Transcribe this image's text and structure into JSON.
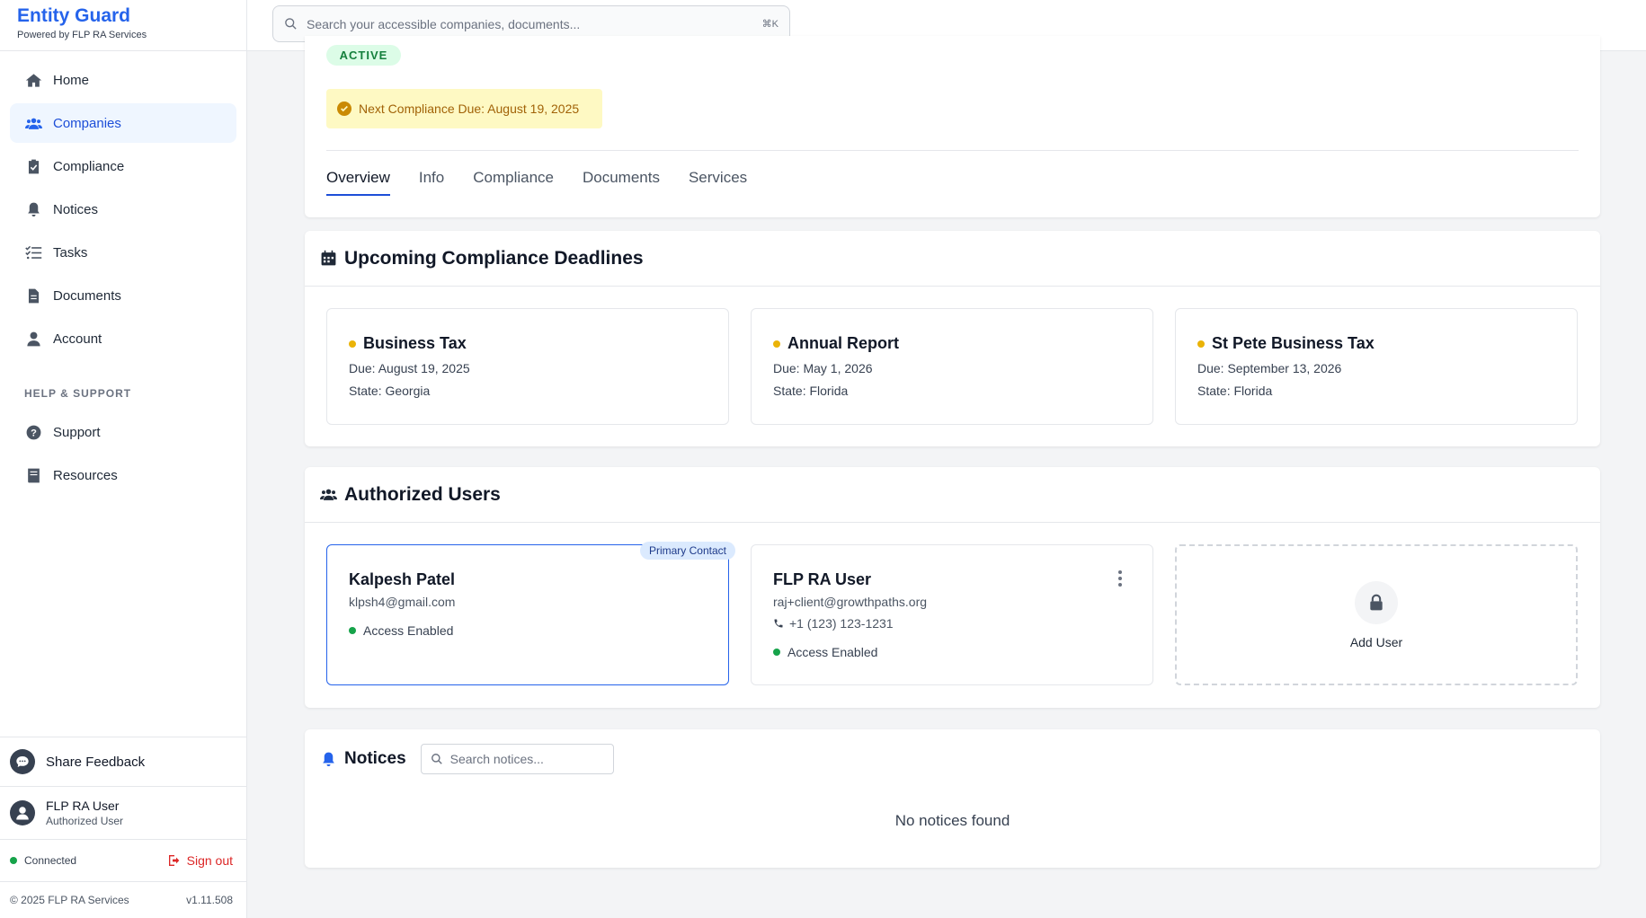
{
  "brand": {
    "title": "Entity Guard",
    "subtitle": "Powered by FLP RA Services"
  },
  "search": {
    "placeholder": "Search your accessible companies, documents...",
    "shortcut": "⌘K"
  },
  "nav": {
    "items": [
      {
        "label": "Home",
        "icon": "home-icon"
      },
      {
        "label": "Companies",
        "icon": "users-icon",
        "active": true
      },
      {
        "label": "Compliance",
        "icon": "clipboard-check-icon"
      },
      {
        "label": "Notices",
        "icon": "bell-icon"
      },
      {
        "label": "Tasks",
        "icon": "list-check-icon"
      },
      {
        "label": "Documents",
        "icon": "document-icon"
      },
      {
        "label": "Account",
        "icon": "user-icon"
      }
    ],
    "help_label": "HELP & SUPPORT",
    "help_items": [
      {
        "label": "Support",
        "icon": "question-circle-icon"
      },
      {
        "label": "Resources",
        "icon": "book-icon"
      }
    ]
  },
  "sidebar_footer": {
    "feedback": "Share Feedback",
    "user_name": "FLP RA User",
    "user_role": "Authorized User",
    "connection": "Connected",
    "sign_out": "Sign out",
    "copyright": "© 2025 FLP RA Services",
    "version": "v1.11.508"
  },
  "company": {
    "status": "ACTIVE",
    "next_due": "Next Compliance Due: August 19, 2025",
    "tabs": [
      "Overview",
      "Info",
      "Compliance",
      "Documents",
      "Services"
    ],
    "active_tab": "Overview"
  },
  "deadlines": {
    "title": "Upcoming Compliance Deadlines",
    "items": [
      {
        "name": "Business Tax",
        "due": "Due: August 19, 2025",
        "state": "State: Georgia"
      },
      {
        "name": "Annual Report",
        "due": "Due: May 1, 2026",
        "state": "State: Florida"
      },
      {
        "name": "St Pete Business Tax",
        "due": "Due: September 13, 2026",
        "state": "State: Florida"
      }
    ]
  },
  "users": {
    "title": "Authorized Users",
    "primary_badge": "Primary Contact",
    "items": [
      {
        "name": "Kalpesh Patel",
        "email": "klpsh4@gmail.com",
        "access": "Access Enabled"
      },
      {
        "name": "FLP RA User",
        "email": "raj+client@growthpaths.org",
        "phone": "+1 (123) 123-1231",
        "access": "Access Enabled"
      }
    ],
    "add_label": "Add User"
  },
  "notices": {
    "title": "Notices",
    "search_placeholder": "Search notices...",
    "empty": "No notices found"
  },
  "colors": {
    "accent": "#2563eb",
    "active_badge": "#dcfce7",
    "due_banner": "#fef9c3",
    "status_green": "#16a34a",
    "status_amber": "#eab308",
    "signout_red": "#dc2626"
  }
}
